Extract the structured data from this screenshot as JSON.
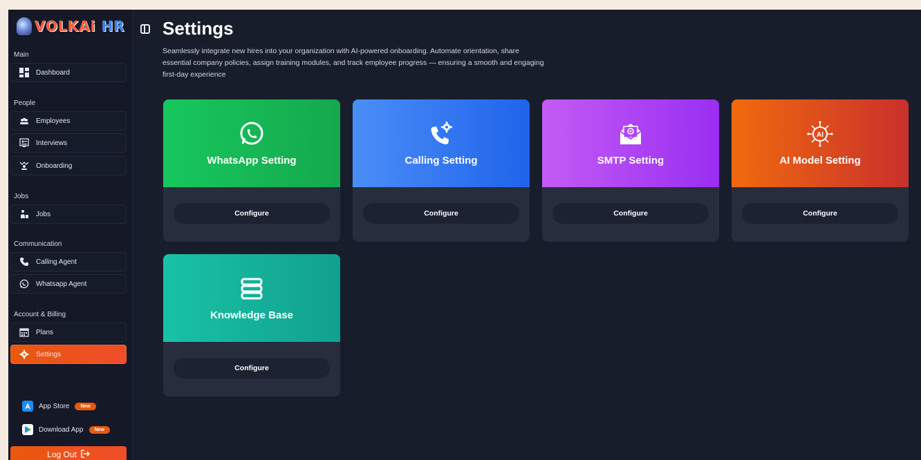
{
  "brand": {
    "name_main": "VOLKAi",
    "name_accent": "HR"
  },
  "sidebar": {
    "sections": [
      {
        "label": "Main"
      },
      {
        "label": "People"
      },
      {
        "label": "Jobs"
      },
      {
        "label": "Communication"
      },
      {
        "label": "Account & Billing"
      }
    ],
    "items": [
      {
        "label": "Dashboard",
        "icon": "dashboard-icon"
      },
      {
        "label": "Employees",
        "icon": "employees-icon"
      },
      {
        "label": "Interviews",
        "icon": "interviews-icon"
      },
      {
        "label": "Onboarding",
        "icon": "onboarding-icon"
      },
      {
        "label": "Jobs",
        "icon": "jobs-icon"
      },
      {
        "label": "Calling Agent",
        "icon": "phone-icon"
      },
      {
        "label": "Whatsapp Agent",
        "icon": "whatsapp-icon"
      },
      {
        "label": "Plans",
        "icon": "plans-icon"
      },
      {
        "label": "Settings",
        "icon": "gear-icon",
        "active": true
      }
    ],
    "apps": [
      {
        "label": "App Store",
        "badge": "New"
      },
      {
        "label": "Download App",
        "badge": "New"
      }
    ],
    "logout_label": "Log Out"
  },
  "page": {
    "title": "Settings",
    "description": "Seamlessly integrate new hires into your organization with AI-powered onboarding. Automate orientation, share essential company policies, assign training modules, and track employee progress — ensuring a smooth and engaging first-day experience"
  },
  "cards": [
    {
      "title": "WhatsApp Setting",
      "button": "Configure",
      "icon": "whatsapp-icon",
      "color": "#16c75c"
    },
    {
      "title": "Calling Setting",
      "button": "Configure",
      "icon": "phone-settings-icon",
      "color": "#2f74f0"
    },
    {
      "title": "SMTP Setting",
      "button": "Configure",
      "icon": "email-icon",
      "color": "#ad45f4"
    },
    {
      "title": "AI Model Setting",
      "button": "Configure",
      "icon": "ai-chip-icon",
      "color": "#e4541a"
    },
    {
      "title": "Knowledge Base",
      "button": "Configure",
      "icon": "database-icon",
      "color": "#14b29b"
    }
  ],
  "colors": {
    "accent": "#ea580c",
    "background": "#181d2c",
    "sidebar": "#141827"
  }
}
